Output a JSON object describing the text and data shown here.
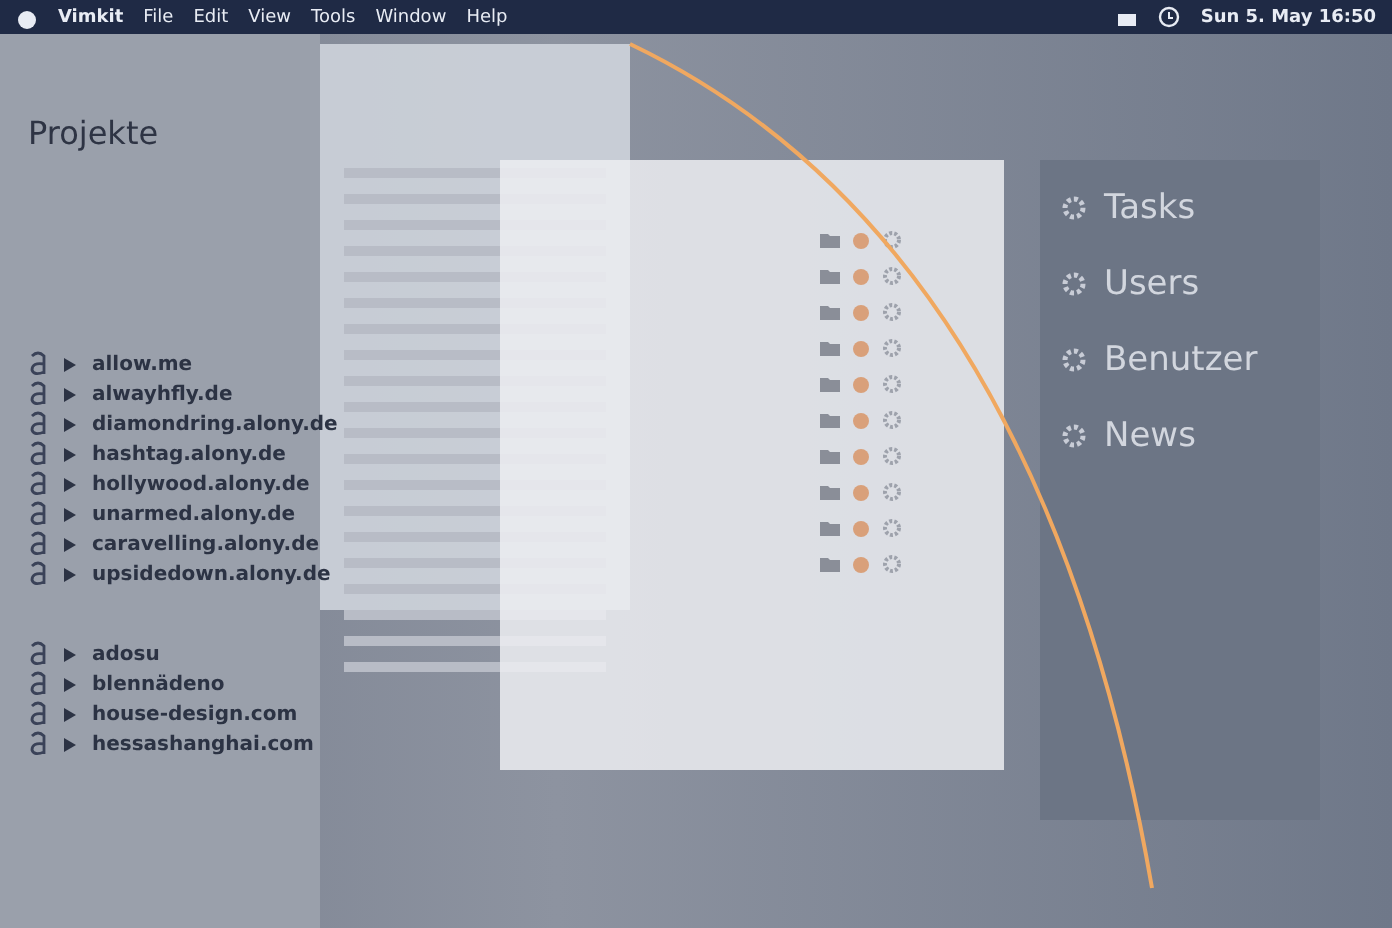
{
  "menu_bar": {
    "items": [
      "Vimkit",
      "File",
      "Edit",
      "View",
      "Tools",
      "Window",
      "Help"
    ],
    "clock": "Sun 5. May  16:50"
  },
  "sidebar": {
    "heading": "Projekte",
    "groups": [
      {
        "domains": [
          "allow.me",
          "alwayhfly.de",
          "diamondring.alony.de",
          "hashtag.alony.de",
          "hollywood.alony.de",
          "unarmed.alony.de",
          "caravelling.alony.de",
          "upsidedown.alony.de"
        ]
      },
      {
        "domains": [
          "adosu",
          "blennädeno",
          "house-design.com",
          "hessashanghai.com"
        ]
      }
    ]
  },
  "right_panel": {
    "items": [
      "Tasks",
      "Users",
      "Benutzer",
      "News"
    ]
  }
}
